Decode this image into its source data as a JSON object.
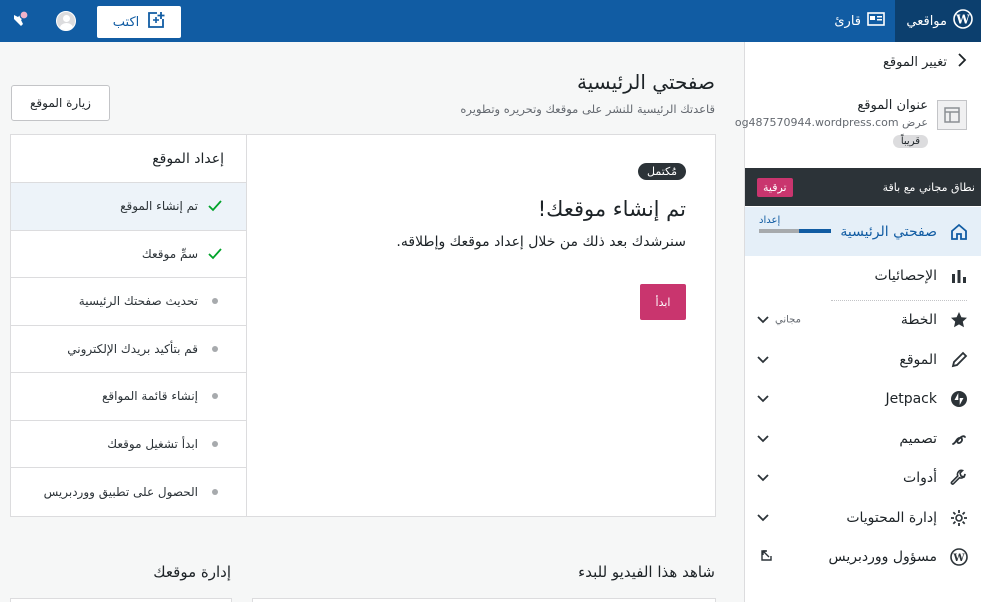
{
  "topbar": {
    "my_sites": "مواقعي",
    "reader": "قارئ",
    "write": "اكتب"
  },
  "sidebar": {
    "switch_site": "تغيير الموقع",
    "site": {
      "title": "عنوان الموقع",
      "url": "عرض og487570944.wordpress.com",
      "status": "قريباً"
    },
    "plan": {
      "text": "نطاق مجاني مع باقة",
      "upgrade": "ترقية"
    },
    "nav": [
      {
        "label": "صفحتي الرئيسية",
        "icon": "home-icon",
        "setup_label": "إعداد",
        "setup_progress": 0.45
      },
      {
        "label": "الإحصائيات",
        "icon": "stats-icon"
      },
      {
        "label": "الخطة",
        "icon": "star-icon",
        "extra": "مجاني"
      },
      {
        "label": "الموقع",
        "icon": "pencil-icon"
      },
      {
        "label": "Jetpack",
        "icon": "jetpack-icon"
      },
      {
        "label": "تصميم",
        "icon": "brush-icon"
      },
      {
        "label": "أدوات",
        "icon": "wrench-icon"
      },
      {
        "label": "إدارة المحتويات",
        "icon": "gear-icon"
      },
      {
        "label": "مسؤول ووردبريس",
        "icon": "wordpress-icon"
      }
    ]
  },
  "main": {
    "title": "صفحتي الرئيسية",
    "subtitle": "قاعدتك الرئيسية للنشر على موقعك وتحريره وتطويره",
    "visit_site": "زيارة الموقع",
    "checklist": {
      "title": "إعداد الموقع",
      "items": [
        {
          "label": "تم إنشاء الموقع",
          "done": true
        },
        {
          "label": "سمِّ موقعك",
          "done": true
        },
        {
          "label": "تحديث صفحتك الرئيسية",
          "done": false
        },
        {
          "label": "قم بتأكيد بريدك الإلكتروني",
          "done": false
        },
        {
          "label": "إنشاء قائمة المواقع",
          "done": false
        },
        {
          "label": "ابدأ تشغيل موقعك",
          "done": false
        },
        {
          "label": "الحصول على تطبيق ووردبريس",
          "done": false
        }
      ]
    },
    "task": {
      "badge": "مُكتمل",
      "title": "تم إنشاء موقعك!",
      "description": "سنرشدك بعد ذلك من خلال إعداد موقعك وإطلاقه.",
      "start": "ابدأ"
    },
    "sections": {
      "video": "شاهد هذا الفيديو للبدء",
      "manage": "إدارة موقعك"
    }
  },
  "colors": {
    "topbar": "#115ca3",
    "topbar_dark": "#0c3f6e",
    "accent": "#c9356e",
    "success": "#00a32a"
  }
}
